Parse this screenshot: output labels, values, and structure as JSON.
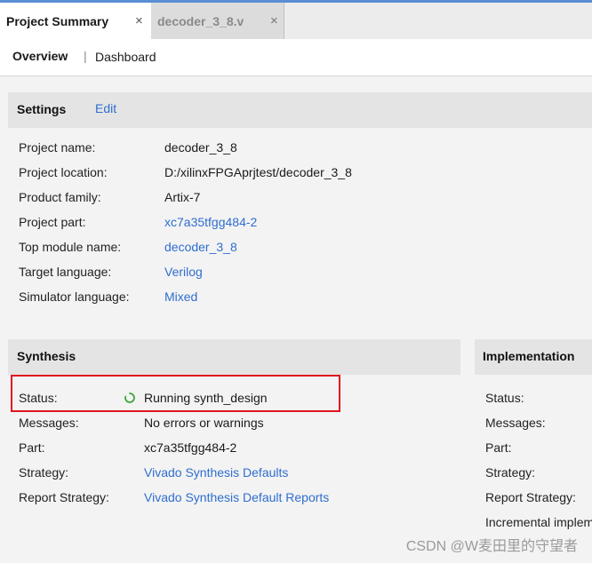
{
  "tabs": [
    {
      "label": "Project Summary",
      "close": "×"
    },
    {
      "label": "decoder_3_8.v",
      "close": "×"
    }
  ],
  "subnav": {
    "overview": "Overview",
    "separator": "|",
    "dashboard": "Dashboard"
  },
  "settings": {
    "title": "Settings",
    "edit": "Edit",
    "rows": [
      {
        "label": "Project name:",
        "value": "decoder_3_8"
      },
      {
        "label": "Project location:",
        "value": "D:/xilinxFPGAprjtest/decoder_3_8"
      },
      {
        "label": "Product family:",
        "value": "Artix-7"
      },
      {
        "label": "Project part:",
        "value": "xc7a35tfgg484-2"
      },
      {
        "label": "Top module name:",
        "value": "decoder_3_8"
      },
      {
        "label": "Target language:",
        "value": "Verilog"
      },
      {
        "label": "Simulator language:",
        "value": "Mixed"
      }
    ]
  },
  "synthesis": {
    "title": "Synthesis",
    "rows": [
      {
        "label": "Status:",
        "value": "Running synth_design"
      },
      {
        "label": "Messages:",
        "value": "No errors or warnings"
      },
      {
        "label": "Part:",
        "value": "xc7a35tfgg484-2"
      },
      {
        "label": "Strategy:",
        "value": "Vivado Synthesis Defaults"
      },
      {
        "label": "Report Strategy:",
        "value": "Vivado Synthesis Default Reports"
      }
    ],
    "status_color": "#e0141e",
    "spinner_color": "#3aa63a"
  },
  "implementation": {
    "title": "Implementation",
    "rows": [
      {
        "label": "Status:"
      },
      {
        "label": "Messages:"
      },
      {
        "label": "Part:"
      },
      {
        "label": "Strategy:"
      },
      {
        "label": "Report Strategy:"
      },
      {
        "label": "Incremental implem"
      }
    ]
  },
  "watermark": "CSDN @W麦田里的守望者",
  "colors": {
    "tab_accent": "#5a8ed5",
    "link": "#2f6ecf",
    "section_header_bg": "#e4e4e4",
    "content_bg": "#f3f3f3"
  }
}
